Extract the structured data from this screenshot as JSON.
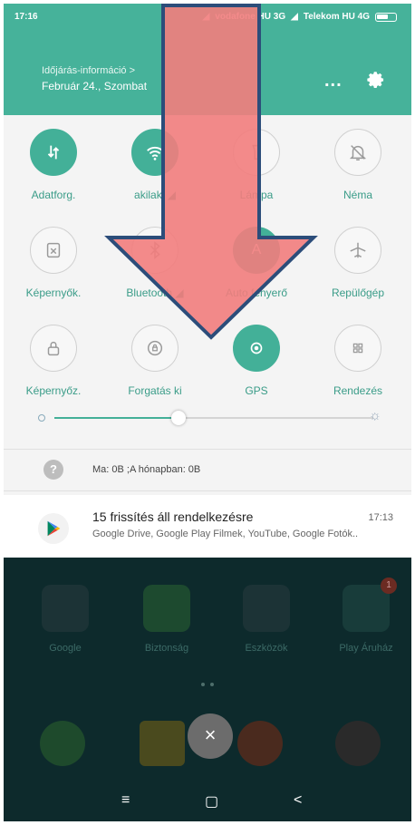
{
  "status_bar": {
    "time": "17:16",
    "carrier1": "vodafone HU 3G",
    "carrier2": "Telekom HU 4G"
  },
  "header": {
    "weather_title": "Időjárás-információ >",
    "date": "Február 24., Szombat",
    "more_icon": "...",
    "settings_icon": "gear-icon"
  },
  "tiles": [
    {
      "label": "Adatforg.",
      "on": true,
      "icon": "data-transfer-icon"
    },
    {
      "label": "akilaki",
      "on": true,
      "icon": "wifi-icon"
    },
    {
      "label": "Lámpa",
      "on": false,
      "icon": "flashlight-icon"
    },
    {
      "label": "Néma",
      "on": false,
      "icon": "bell-off-icon"
    },
    {
      "label": "Képernyők.",
      "on": false,
      "icon": "screenshot-icon"
    },
    {
      "label": "Bluetooth",
      "on": false,
      "icon": "bluetooth-icon"
    },
    {
      "label": "Auto fényerő",
      "on": true,
      "icon": "auto-brightness-icon"
    },
    {
      "label": "Repülőgép",
      "on": false,
      "icon": "airplane-icon"
    },
    {
      "label": "Képernyőz.",
      "on": false,
      "icon": "lock-icon"
    },
    {
      "label": "Forgatás ki",
      "on": false,
      "icon": "rotation-lock-icon"
    },
    {
      "label": "GPS",
      "on": true,
      "icon": "gps-icon"
    },
    {
      "label": "Rendezés",
      "on": false,
      "icon": "grid-icon"
    }
  ],
  "brightness": {
    "level": 0.39
  },
  "data_usage": {
    "text": "Ma: 0B ;A hónapban: 0B"
  },
  "notification": {
    "title": "15 frissítés áll rendelkezésre",
    "time": "17:13",
    "body": "Google Drive, Google Play Filmek, YouTube, Google Fotók..",
    "icon": "google-play-icon"
  },
  "home_apps": [
    {
      "name": "Google"
    },
    {
      "name": "Biztonság"
    },
    {
      "name": "Eszközök"
    },
    {
      "name": "Play Áruház"
    }
  ],
  "play_store_badge": "1",
  "close_label": "×",
  "nav": {
    "menu": "≡",
    "home": "▢",
    "back": "<"
  },
  "colors": {
    "accent": "#43b098",
    "header": "#46b29a",
    "overlay_arrow": "#f27d7d",
    "arrow_outline": "#2c4d7a"
  }
}
